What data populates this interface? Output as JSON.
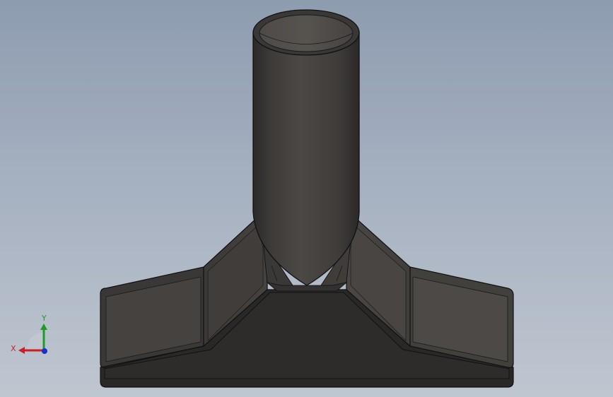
{
  "viewport": {
    "background_top": "#8e9cb0",
    "background_bottom": "#bfc6d0"
  },
  "model": {
    "name": "tube-tee-bracket",
    "body_color": "#3d3a38",
    "face_color": "#4a4745",
    "edge_color": "#141414"
  },
  "triad": {
    "x_label": "X",
    "y_label": "Y",
    "x_color": "#cc1f1f",
    "y_color": "#1e9a2a",
    "z_color": "#1a2fd0"
  }
}
